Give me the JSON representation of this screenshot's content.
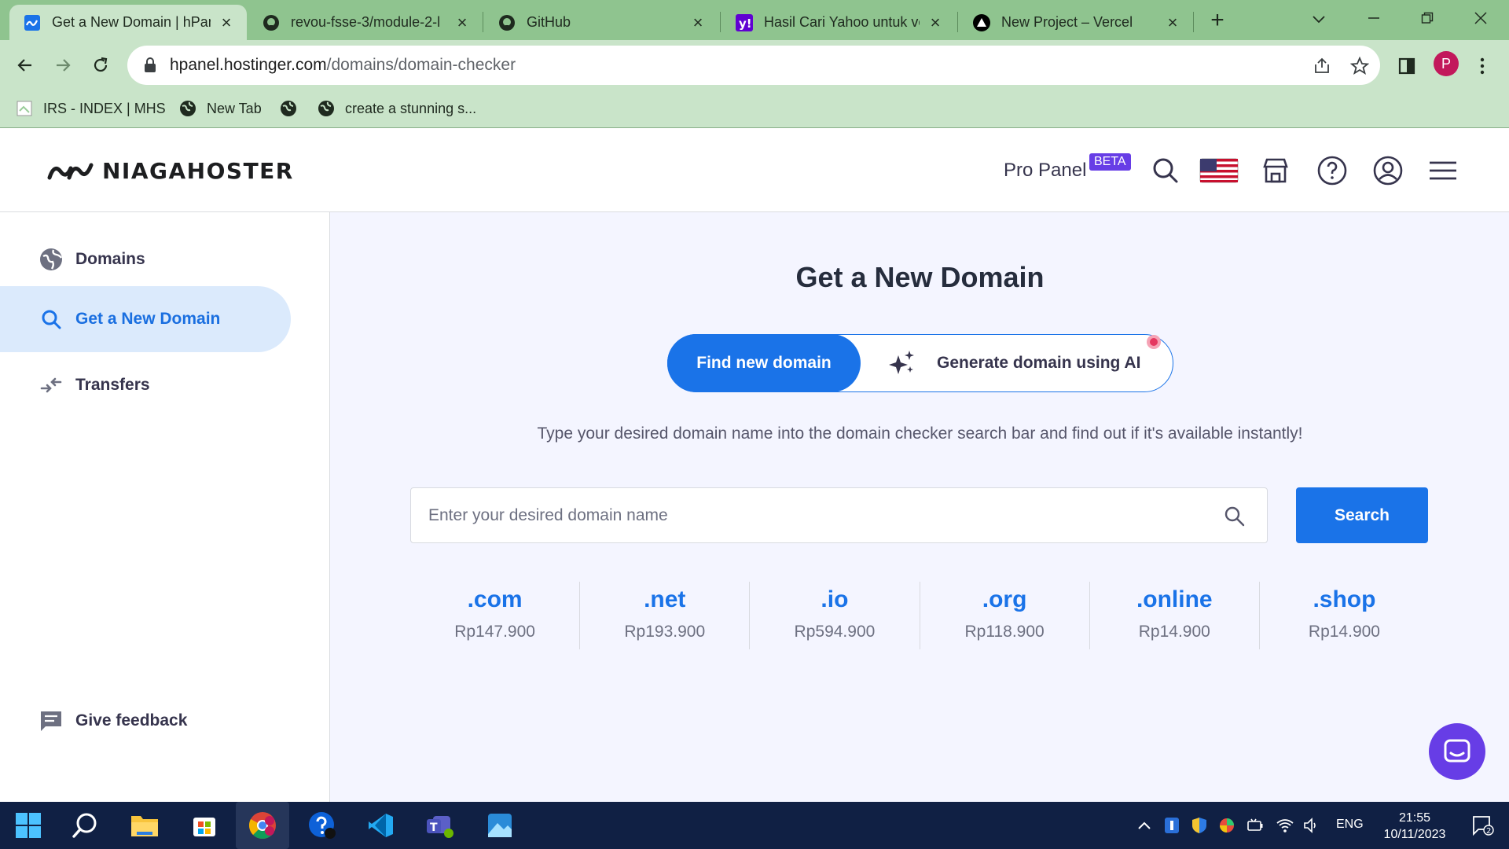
{
  "browser": {
    "tabs": [
      {
        "title": "Get a New Domain | hPanel",
        "favicon": "hostinger-icon",
        "active": true
      },
      {
        "title": "revou-fsse-3/module-2-l",
        "favicon": "github-icon",
        "active": false
      },
      {
        "title": "GitHub",
        "favicon": "github-icon",
        "active": false
      },
      {
        "title": "Hasil Cari Yahoo untuk ve",
        "favicon": "yahoo-icon",
        "active": false
      },
      {
        "title": "New Project – Vercel",
        "favicon": "vercel-icon",
        "active": false
      }
    ],
    "url_host": "hpanel.hostinger.com",
    "url_path": "/domains/domain-checker",
    "profile_initial": "P",
    "bookmarks": [
      {
        "label": "IRS - INDEX | MHS",
        "icon": "page-icon"
      },
      {
        "label": "New Tab",
        "icon": "globe-icon"
      },
      {
        "label": "",
        "icon": "globe-icon"
      },
      {
        "label": "create a stunning s...",
        "icon": "globe-icon"
      }
    ]
  },
  "header": {
    "brand": "NIAGAHOSTER",
    "pro_panel": "Pro Panel",
    "beta": "BETA"
  },
  "sidebar": {
    "items": [
      {
        "label": "Domains",
        "icon": "globe-icon",
        "active": false
      },
      {
        "label": "Get a New Domain",
        "icon": "search-icon",
        "active": true
      },
      {
        "label": "Transfers",
        "icon": "transfer-icon",
        "active": false
      }
    ],
    "feedback": "Give feedback"
  },
  "main": {
    "title": "Get a New Domain",
    "find_label": "Find new domain",
    "ai_label": "Generate domain using AI",
    "subtitle": "Type your desired domain name into the domain checker search bar and find out if it's available instantly!",
    "search_placeholder": "Enter your desired domain name",
    "search_button": "Search",
    "tlds": [
      {
        "ext": ".com",
        "price": "Rp147.900"
      },
      {
        "ext": ".net",
        "price": "Rp193.900"
      },
      {
        "ext": ".io",
        "price": "Rp594.900"
      },
      {
        "ext": ".org",
        "price": "Rp118.900"
      },
      {
        "ext": ".online",
        "price": "Rp14.900"
      },
      {
        "ext": ".shop",
        "price": "Rp14.900"
      }
    ]
  },
  "taskbar": {
    "lang": "ENG",
    "time": "21:55",
    "date": "10/11/2023",
    "notifications": "2"
  },
  "colors": {
    "accent": "#1a73e8",
    "brand_purple": "#673de6",
    "chrome_green": "#8fc48f"
  }
}
